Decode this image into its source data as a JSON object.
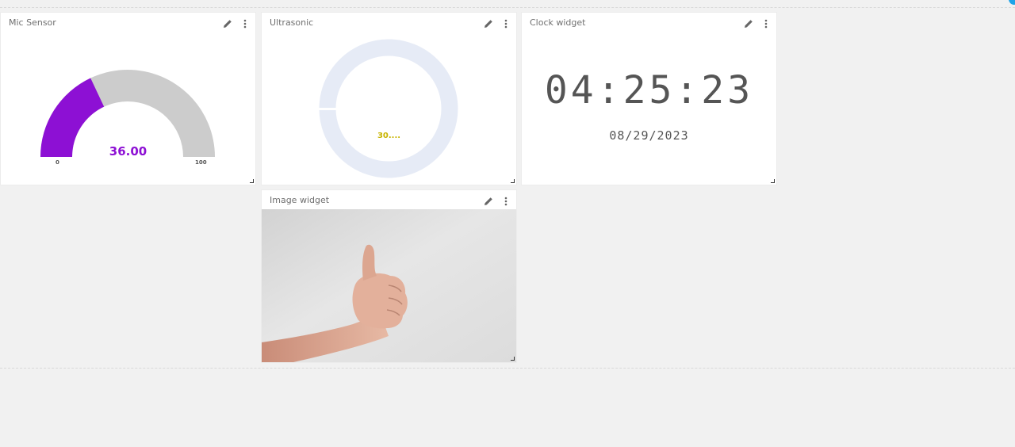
{
  "widgets": {
    "mic": {
      "title": "Mic Sensor",
      "value": "36.00",
      "value_num": 36,
      "min": "0",
      "max": "100",
      "fill_color": "#8d10d4",
      "track_color": "#cccccc"
    },
    "ultrasonic": {
      "title": "Ultrasonic",
      "value": "30....",
      "value_color": "#c8b400",
      "ring_color": "#e6ebf6"
    },
    "clock": {
      "title": "Clock widget",
      "time": "04:25:23",
      "date": "08/29/2023"
    },
    "image": {
      "title": "Image widget",
      "subject": "thumbs-up hand on light gray background"
    }
  },
  "icons": {
    "edit": "pencil-icon",
    "more": "vertical-ellipsis-icon",
    "resize": "resize-handle-icon"
  },
  "colors": {
    "background": "#f1f1f1",
    "card": "#ffffff",
    "accent": "#1fa3e8"
  }
}
